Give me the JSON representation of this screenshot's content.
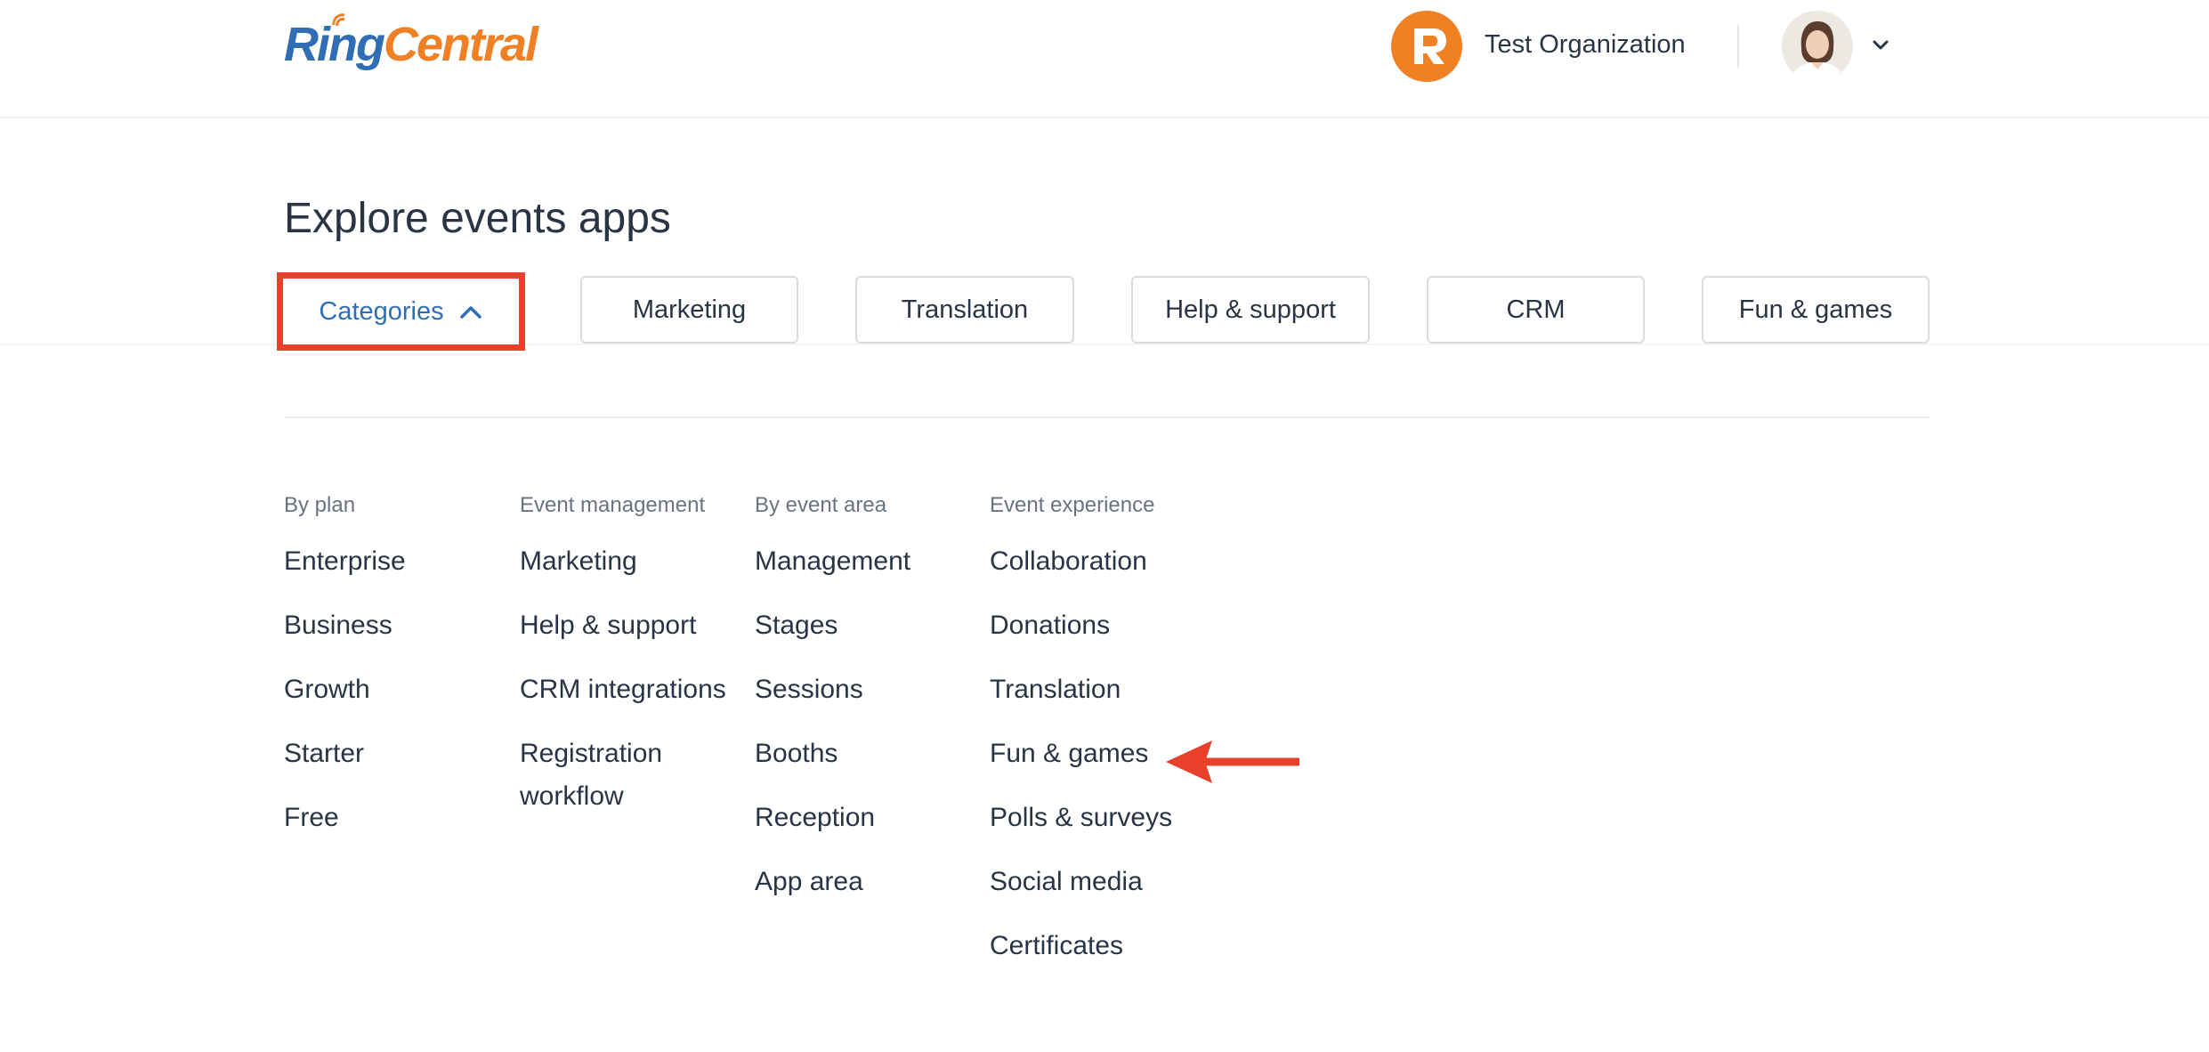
{
  "header": {
    "logo_part1": "Ring",
    "logo_part2": "Central",
    "org_name": "Test Organization",
    "brand_orange": "#f08024",
    "brand_blue": "#2f6db5"
  },
  "page": {
    "title": "Explore events apps"
  },
  "tabs": {
    "categories": "Categories",
    "items": [
      "Marketing",
      "Translation",
      "Help & support",
      "CRM",
      "Fun & games"
    ]
  },
  "categories": {
    "by_plan": {
      "heading": "By plan",
      "items": [
        "Enterprise",
        "Business",
        "Growth",
        "Starter",
        "Free"
      ]
    },
    "event_management": {
      "heading": "Event management",
      "items": [
        "Marketing",
        "Help & support",
        "CRM integrations",
        "Registration workflow"
      ]
    },
    "by_event_area": {
      "heading": "By event area",
      "items": [
        "Management",
        "Stages",
        "Sessions",
        "Booths",
        "Reception",
        "App area"
      ]
    },
    "event_experience": {
      "heading": "Event experience",
      "items": [
        "Collaboration",
        "Donations",
        "Translation",
        "Fun & games",
        "Polls & surveys",
        "Social media",
        "Certificates"
      ]
    }
  },
  "annotations": {
    "highlight_color": "#e8402a"
  }
}
